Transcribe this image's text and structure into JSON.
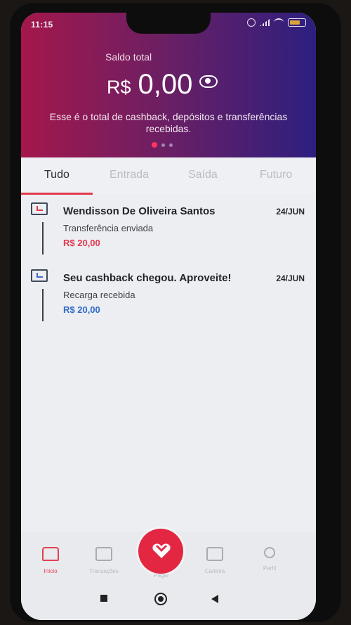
{
  "status_bar": {
    "time": "11:15"
  },
  "balance": {
    "label": "Saldo total",
    "currency": "R$",
    "value": "0,00",
    "description": "Esse é o total de cashback, depósitos e transferências recebidas."
  },
  "carousel": {
    "active_dot": 1,
    "dot_count": 3
  },
  "tabs": [
    {
      "label": "Tudo",
      "active": true
    },
    {
      "label": "Entrada",
      "active": false
    },
    {
      "label": "Saída",
      "active": false
    },
    {
      "label": "Futuro",
      "active": false
    }
  ],
  "transactions": [
    {
      "name": "Wendisson De Oliveira Santos",
      "date": "24/JUN",
      "type": "Transferência enviada",
      "amount": "R$ 20,00",
      "direction": "out"
    },
    {
      "name": "Seu cashback chegou. Aproveite!",
      "date": "24/JUN",
      "type": "Recarga recebida",
      "amount": "R$ 20,00",
      "direction": "in"
    }
  ],
  "bottom_nav": [
    {
      "label": "Início",
      "icon": "home-icon",
      "active": true
    },
    {
      "label": "Transações",
      "icon": "transactions-icon",
      "active": false
    },
    {
      "label": "Pagar",
      "icon": "heart-icon",
      "active": false
    },
    {
      "label": "Carteira",
      "icon": "wallet-icon",
      "active": false
    },
    {
      "label": "Perfil",
      "icon": "user-icon",
      "active": false
    }
  ],
  "colors": {
    "brand_red": "#e32742",
    "hero_gradient_start": "#a4174c",
    "hero_gradient_end": "#2d1f7f",
    "amount_out": "#e1374f",
    "amount_in": "#2f69c9"
  }
}
